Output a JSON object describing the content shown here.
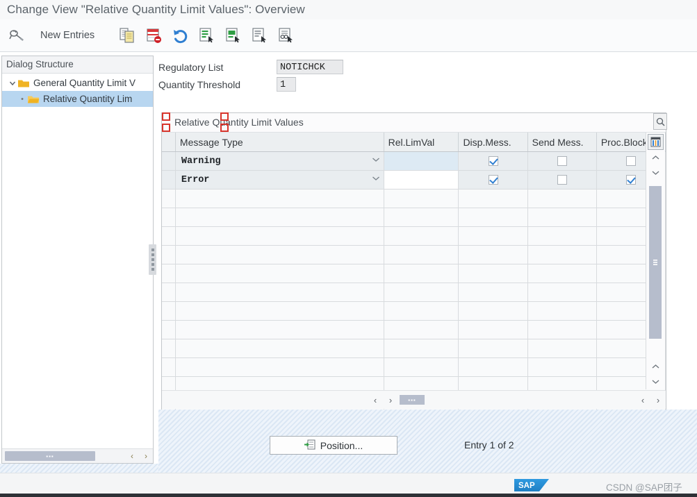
{
  "window": {
    "title": "Change View \"Relative Quantity Limit Values\": Overview"
  },
  "toolbar": {
    "display_change_icon": "display-change-icon",
    "new_entries_label": "New Entries",
    "items": [
      {
        "name": "copy-as-icon",
        "icon": "copy-as-icon"
      },
      {
        "name": "delete-icon",
        "icon": "delete-icon"
      },
      {
        "name": "undo-icon",
        "icon": "undo-icon"
      },
      {
        "name": "select-all-icon",
        "icon": "select-all-icon"
      },
      {
        "name": "select-block-icon",
        "icon": "select-block-icon"
      },
      {
        "name": "deselect-all-icon",
        "icon": "deselect-all-icon"
      },
      {
        "name": "select-details-icon",
        "icon": "select-details-icon"
      }
    ]
  },
  "sidebar": {
    "header": "Dialog Structure",
    "items": [
      {
        "label": "General Quantity Limit V",
        "level": 0,
        "selected": false,
        "expanded": true
      },
      {
        "label": "Relative Quantity Lim",
        "level": 1,
        "selected": true,
        "expanded": false
      }
    ],
    "scrollbar": {
      "left_arrow": "‹",
      "right_arrow": "›",
      "thumb_grip": "▪▪▪"
    }
  },
  "form": {
    "fields": [
      {
        "label": "Regulatory List",
        "value": "NOTICHCK"
      },
      {
        "label": "Quantity Threshold",
        "value": "1"
      }
    ]
  },
  "table": {
    "caption": "Relative Quantity Limit Values",
    "columns": [
      {
        "key": "msg",
        "label": "Message Type"
      },
      {
        "key": "rel",
        "label": "Rel.LimVal"
      },
      {
        "key": "disp",
        "label": "Disp.Mess."
      },
      {
        "key": "send",
        "label": "Send Mess."
      },
      {
        "key": "proc",
        "label": "Proc.Block"
      }
    ],
    "rows": [
      {
        "msg": "Warning",
        "rel": "",
        "disp": true,
        "send": false,
        "proc": false,
        "focused": true
      },
      {
        "msg": "Error",
        "rel": "",
        "disp": true,
        "send": false,
        "proc": true
      }
    ],
    "empty_row_count": 12,
    "config_icon": "table-settings-icon",
    "scroll": {
      "up_arrow": "⌃",
      "down_arrow": "⌄",
      "left_arrow": "‹",
      "right_arrow": "›",
      "thumb_grip": "▪▪▪"
    }
  },
  "footer": {
    "position_button": "Position...",
    "position_icon": "position-icon",
    "entry_status": "Entry 1 of 2"
  },
  "status": {
    "logo": "SAP",
    "watermark": "CSDN @SAP团子"
  },
  "colors": {
    "accent": "#2f7fd1",
    "focus_red": "#d8342b",
    "folder_yellow": "#f0b323",
    "selection_blue": "#b8d6f0",
    "sap_blue": "#2e9ae0"
  }
}
